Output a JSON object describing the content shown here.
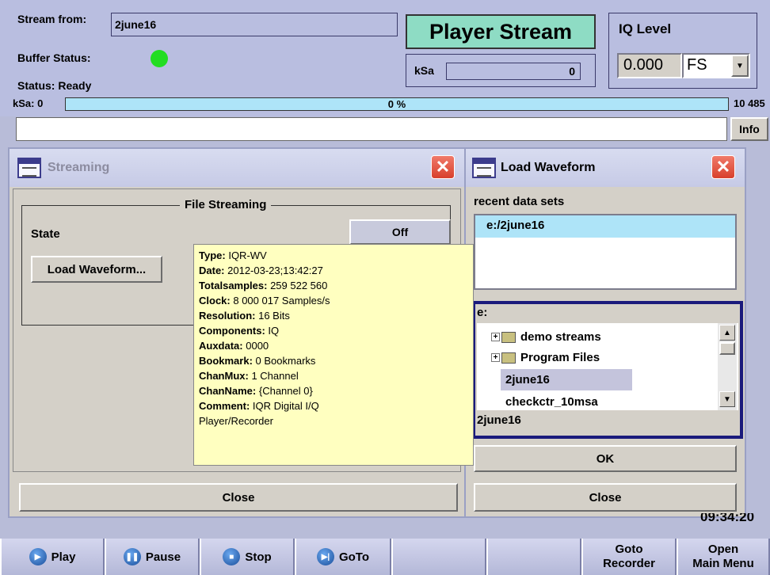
{
  "header": {
    "stream_from_label": "Stream from:",
    "stream_from_value": "2june16",
    "buffer_status_label": "Buffer Status:",
    "buffer_status_color": "#22dd22",
    "status_text": "Status: Ready",
    "mode_title": "Player Stream",
    "ksa_label": "kSa",
    "ksa_value": "0",
    "iq_level_label": "IQ Level",
    "iq_level_value": "0.000",
    "iq_level_unit": "FS",
    "progress_left": "kSa: 0",
    "progress_text": "0 %",
    "progress_fraction": 0.0,
    "progress_right": "10 485",
    "info_label": "Info"
  },
  "streaming": {
    "title": "Streaming",
    "group_title": "File Streaming",
    "state_label": "State",
    "state_value": "Off",
    "load_button": "Load Waveform...",
    "close_button": "Close"
  },
  "tooltip": {
    "rows": [
      {
        "k": "Type:",
        "v": " IQR-WV"
      },
      {
        "k": "Date:",
        "v": " 2012-03-23;13:42:27"
      },
      {
        "k": "Totalsamples:",
        "v": " 259 522 560"
      },
      {
        "k": "Clock:",
        "v": " 8 000 017 Samples/s"
      },
      {
        "k": "Resolution:",
        "v": " 16 Bits"
      },
      {
        "k": "Components:",
        "v": " IQ"
      },
      {
        "k": "Auxdata:",
        "v": " 0000"
      },
      {
        "k": "Bookmark:",
        "v": " 0 Bookmarks"
      },
      {
        "k": "ChanMux:",
        "v": " 1 Channel"
      },
      {
        "k": "ChanName:",
        "v": " {Channel 0}"
      },
      {
        "k": "Comment:",
        "v": " IQR Digital I/Q"
      }
    ],
    "last_line": "Player/Recorder"
  },
  "load_waveform": {
    "title": "Load Waveform",
    "recent_label": "recent data sets",
    "recent_items": [
      "e:/2june16"
    ],
    "drive_label": "e:",
    "tree_items": [
      "demo streams",
      "Program Files",
      "2june16",
      "checkctr_10msa"
    ],
    "selected_file": "2june16",
    "ok_button": "OK",
    "close_button": "Close"
  },
  "clock_partial": "09:34:20",
  "bottom": {
    "play": "Play",
    "pause": "Pause",
    "stop": "Stop",
    "goto": "GoTo",
    "goto_recorder_1": "Goto",
    "goto_recorder_2": "Recorder",
    "open_menu_1": "Open",
    "open_menu_2": "Main Menu"
  }
}
